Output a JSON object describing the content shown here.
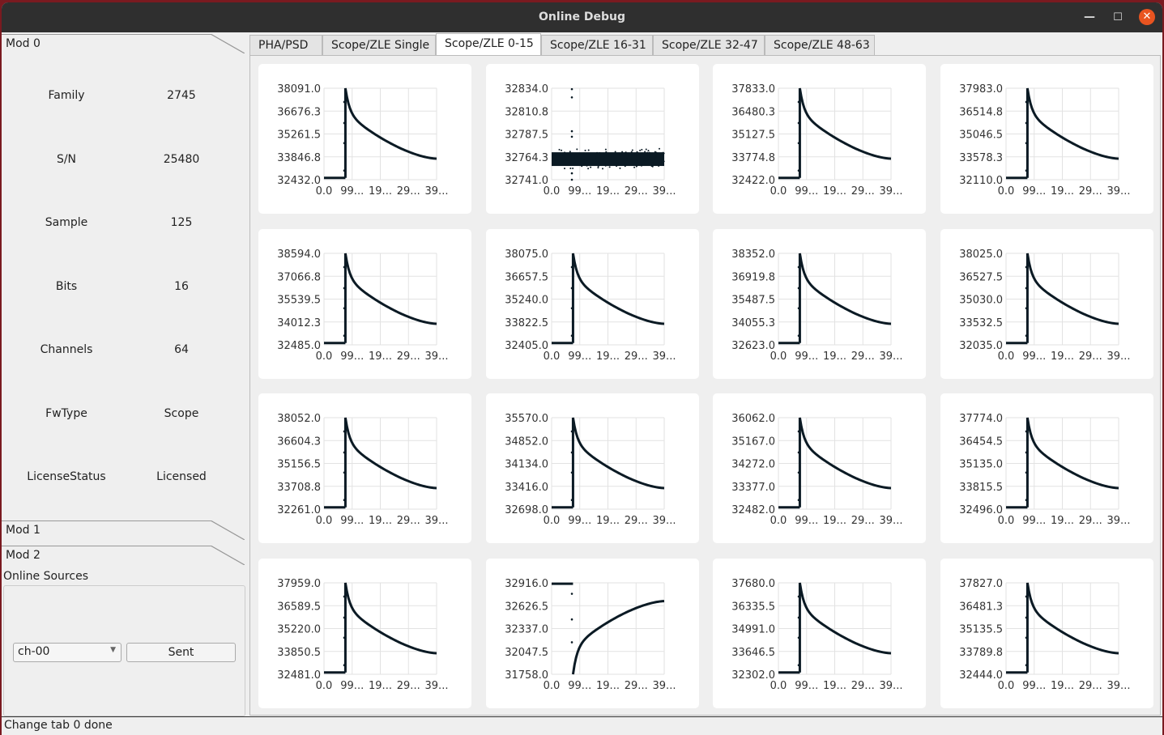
{
  "window": {
    "title": "Online Debug",
    "minimize_icon": "minimize-icon",
    "maximize_icon": "maximize-icon",
    "close_icon": "close-icon"
  },
  "left": {
    "mod0": "Mod 0",
    "mod1": "Mod 1",
    "mod2": "Mod 2",
    "props": [
      {
        "label": "Family",
        "value": "2745"
      },
      {
        "label": "S/N",
        "value": "25480"
      },
      {
        "label": "Sample",
        "value": "125"
      },
      {
        "label": "Bits",
        "value": "16"
      },
      {
        "label": "Channels",
        "value": "64"
      },
      {
        "label": "FwType",
        "value": "Scope"
      },
      {
        "label": "LicenseStatus",
        "value": "Licensed"
      }
    ],
    "online_sources": "Online Sources",
    "channel_select": "ch-00",
    "sent_button": "Sent"
  },
  "tabs": [
    {
      "label": "PHA/PSD"
    },
    {
      "label": "Scope/ZLE Single"
    },
    {
      "label": "Scope/ZLE 0-15",
      "active": true
    },
    {
      "label": "Scope/ZLE 16-31"
    },
    {
      "label": "Scope/ZLE 32-47"
    },
    {
      "label": "Scope/ZLE 48-63"
    }
  ],
  "status": "Change tab 0 done",
  "chart_data": {
    "type": "scatter",
    "x_tick_labels": [
      "0.0",
      "99...",
      "19...",
      "29...",
      "39..."
    ],
    "grid": true,
    "point_color": "#0b1a24",
    "charts": [
      {
        "y_ticks": [
          "38091.0",
          "36676.3",
          "35261.5",
          "33846.8",
          "32432.0"
        ],
        "waveform": "decay"
      },
      {
        "y_ticks": [
          "32834.0",
          "32810.8",
          "32787.5",
          "32764.3",
          "32741.0"
        ],
        "waveform": "noise"
      },
      {
        "y_ticks": [
          "37833.0",
          "36480.3",
          "35127.5",
          "33774.8",
          "32422.0"
        ],
        "waveform": "decay"
      },
      {
        "y_ticks": [
          "37983.0",
          "36514.8",
          "35046.5",
          "33578.3",
          "32110.0"
        ],
        "waveform": "decay"
      },
      {
        "y_ticks": [
          "38594.0",
          "37066.8",
          "35539.5",
          "34012.3",
          "32485.0"
        ],
        "waveform": "decay"
      },
      {
        "y_ticks": [
          "38075.0",
          "36657.5",
          "35240.0",
          "33822.5",
          "32405.0"
        ],
        "waveform": "decay"
      },
      {
        "y_ticks": [
          "38352.0",
          "36919.8",
          "35487.5",
          "34055.3",
          "32623.0"
        ],
        "waveform": "decay"
      },
      {
        "y_ticks": [
          "38025.0",
          "36527.5",
          "35030.0",
          "33532.5",
          "32035.0"
        ],
        "waveform": "decay"
      },
      {
        "y_ticks": [
          "38052.0",
          "36604.3",
          "35156.5",
          "33708.8",
          "32261.0"
        ],
        "waveform": "decay"
      },
      {
        "y_ticks": [
          "35570.0",
          "34852.0",
          "34134.0",
          "33416.0",
          "32698.0"
        ],
        "waveform": "decay"
      },
      {
        "y_ticks": [
          "36062.0",
          "35167.0",
          "34272.0",
          "33377.0",
          "32482.0"
        ],
        "waveform": "decay"
      },
      {
        "y_ticks": [
          "37774.0",
          "36454.5",
          "35135.0",
          "33815.5",
          "32496.0"
        ],
        "waveform": "decay"
      },
      {
        "y_ticks": [
          "37959.0",
          "36589.5",
          "35220.0",
          "33850.5",
          "32481.0"
        ],
        "waveform": "decay"
      },
      {
        "y_ticks": [
          "32916.0",
          "32626.5",
          "32337.0",
          "32047.5",
          "31758.0"
        ],
        "waveform": "rise"
      },
      {
        "y_ticks": [
          "37680.0",
          "36335.5",
          "34991.0",
          "33646.5",
          "32302.0"
        ],
        "waveform": "decay"
      },
      {
        "y_ticks": [
          "37827.0",
          "36481.3",
          "35135.5",
          "33789.8",
          "32444.0"
        ],
        "waveform": "decay"
      }
    ]
  }
}
